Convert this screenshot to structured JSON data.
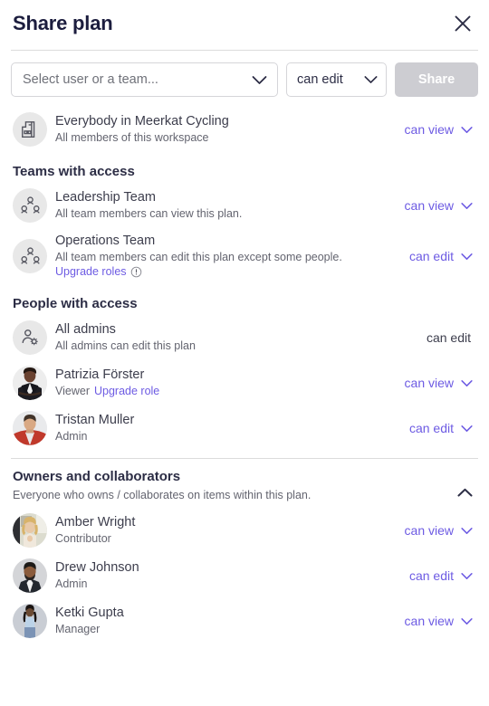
{
  "header": {
    "title": "Share plan",
    "close_icon": "close-icon"
  },
  "invite": {
    "user_select_placeholder": "Select user or a team...",
    "user_select_icon": "chevron-down-icon",
    "role_value": "can edit",
    "role_icon": "chevron-down-icon",
    "share_label": "Share"
  },
  "workspace": {
    "icon": "office-building-icon",
    "title": "Everybody in Meerkat Cycling",
    "subtitle": "All members of this workspace",
    "permission": "can view"
  },
  "teams_section": {
    "heading": "Teams with access",
    "rows": [
      {
        "icon": "team-group-icon",
        "title": "Leadership Team",
        "subtitle": "All team members can view this plan.",
        "permission": "can view",
        "upgrade_link": "",
        "has_upgrade": false
      },
      {
        "icon": "team-group-icon",
        "title": "Operations Team",
        "subtitle": "All team members can edit this plan except some people.",
        "permission": "can edit",
        "upgrade_link": "Upgrade roles",
        "has_upgrade": true
      }
    ]
  },
  "people_section": {
    "heading": "People with access",
    "rows": [
      {
        "avatar_type": "icon",
        "icon": "admin-person-gear-icon",
        "title": "All admins",
        "subtitle": "All admins can edit this plan",
        "permission": "can edit",
        "permission_static": true,
        "role_link": ""
      },
      {
        "avatar_type": "photo",
        "icon": "user-avatar-photo",
        "title": "Patrizia Förster",
        "subtitle": "Viewer",
        "role_link": "Upgrade role",
        "permission": "can view",
        "permission_static": false
      },
      {
        "avatar_type": "photo",
        "icon": "user-avatar-photo",
        "title": "Tristan Muller",
        "subtitle": "Admin",
        "role_link": "",
        "permission": "can edit",
        "permission_static": false
      }
    ]
  },
  "collaborators_section": {
    "heading": "Owners and collaborators",
    "subheading": "Everyone who owns / collaborates on items within this plan.",
    "collapse_icon": "chevron-up-icon",
    "rows": [
      {
        "avatar_type": "photo",
        "icon": "user-avatar-photo",
        "title": "Amber Wright",
        "subtitle": "Contributor",
        "permission": "can view"
      },
      {
        "avatar_type": "photo",
        "icon": "user-avatar-photo",
        "title": "Drew Johnson",
        "subtitle": "Admin",
        "permission": "can edit"
      },
      {
        "avatar_type": "photo",
        "icon": "user-avatar-photo",
        "title": "Ketki Gupta",
        "subtitle": "Manager",
        "permission": "can view"
      }
    ]
  },
  "colors": {
    "accent_purple": "#6d5be3",
    "title_navy": "#1c1d3e",
    "text_gray": "#63646f",
    "disabled_button": "#cdcdd2",
    "border": "#d5d5d9"
  }
}
